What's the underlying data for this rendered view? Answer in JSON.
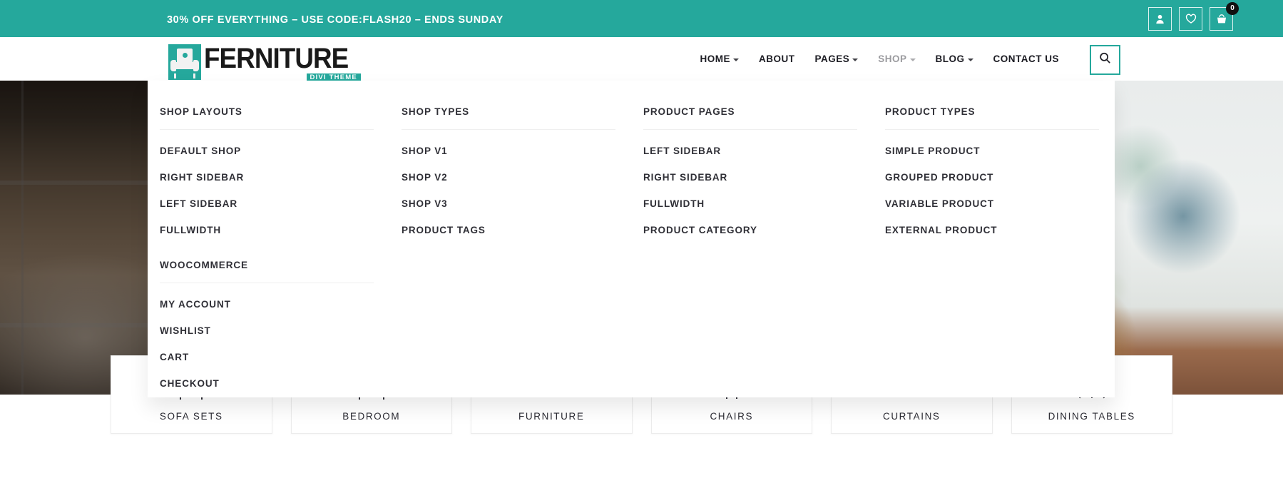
{
  "promo": {
    "text": "30% OFF EVERYTHING – USE CODE:FLASH20 – ENDS SUNDAY",
    "account_icon": "user-icon",
    "wishlist_icon": "heart-icon",
    "cart_icon": "basket-icon",
    "cart_count": "0",
    "accent_color": "#25a89c"
  },
  "brand": {
    "name": "FERNITURE",
    "tagline": "DIVI THEME",
    "mark_icon": "sofa-icon"
  },
  "nav": {
    "items": [
      {
        "label": "HOME",
        "has_caret": true,
        "state": "default"
      },
      {
        "label": "ABOUT",
        "has_caret": false,
        "state": "default"
      },
      {
        "label": "PAGES",
        "has_caret": true,
        "state": "default"
      },
      {
        "label": "SHOP",
        "has_caret": true,
        "state": "open"
      },
      {
        "label": "BLOG",
        "has_caret": true,
        "state": "default"
      },
      {
        "label": "CONTACT US",
        "has_caret": false,
        "state": "default"
      }
    ],
    "search_icon": "search-icon"
  },
  "megamenu": {
    "columns": [
      {
        "groups": [
          {
            "heading": "SHOP LAYOUTS",
            "links": [
              "DEFAULT SHOP",
              "RIGHT SIDEBAR",
              "LEFT SIDEBAR",
              "FULLWIDTH"
            ]
          },
          {
            "heading": "WOOCOMMERCE",
            "links": [
              "MY ACCOUNT",
              "WISHLIST",
              "CART",
              "CHECKOUT"
            ]
          }
        ]
      },
      {
        "groups": [
          {
            "heading": "SHOP TYPES",
            "links": [
              "SHOP V1",
              "SHOP V2",
              "SHOP V3",
              "PRODUCT TAGS"
            ]
          }
        ]
      },
      {
        "groups": [
          {
            "heading": "PRODUCT PAGES",
            "links": [
              "LEFT SIDEBAR",
              "RIGHT SIDEBAR",
              "FULLWIDTH",
              "PRODUCT CATEGORY"
            ]
          }
        ]
      },
      {
        "groups": [
          {
            "heading": "PRODUCT TYPES",
            "links": [
              "SIMPLE PRODUCT",
              "GROUPED PRODUCT",
              "VARIABLE PRODUCT",
              "EXTERNAL PRODUCT"
            ]
          }
        ]
      }
    ]
  },
  "categories": [
    {
      "label": "SOFA SETS",
      "icon": "sofa-category-icon"
    },
    {
      "label": "BEDROOM",
      "icon": "bed-category-icon"
    },
    {
      "label": "FURNITURE",
      "icon": "table-category-icon"
    },
    {
      "label": "CHAIRS",
      "icon": "chair-category-icon"
    },
    {
      "label": "CURTAINS",
      "icon": "curtain-category-icon"
    },
    {
      "label": "DINING TABLES",
      "icon": "dining-category-icon"
    }
  ],
  "hero": {
    "left_scene": "dark-interior-photo",
    "right_scene": "bright-window-plants-photo"
  }
}
